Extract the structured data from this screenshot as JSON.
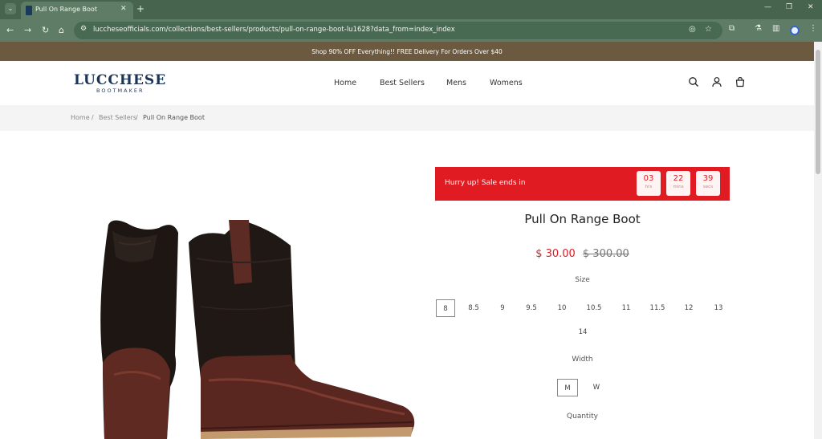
{
  "browser": {
    "tab_title": "Pull On Range Boot",
    "url": "luccheseofficials.com/collections/best-sellers/products/pull-on-range-boot-lu1628?data_from=index_index"
  },
  "promo": {
    "text": "Shop 90% OFF Everything!! FREE Delivery For Orders Over $40"
  },
  "header": {
    "logo_main": "LUCCHESE",
    "logo_sub": "BOOTMAKER",
    "nav": [
      "Home",
      "Best Sellers",
      "Mens",
      "Womens"
    ]
  },
  "breadcrumb": {
    "items": [
      "Home",
      "Best Sellers",
      "Pull On Range Boot"
    ],
    "separator": "/"
  },
  "countdown": {
    "label": "Hurry up!  Sale ends in",
    "units": [
      {
        "value": "03",
        "unit": "hrs"
      },
      {
        "value": "22",
        "unit": "mins"
      },
      {
        "value": "39",
        "unit": "secs"
      }
    ]
  },
  "product": {
    "title": "Pull On Range Boot",
    "price_sale": "$ 30.00",
    "price_original": "$ 300.00",
    "size_label": "Size",
    "sizes": [
      "8",
      "8.5",
      "9",
      "9.5",
      "10",
      "10.5",
      "11",
      "11.5",
      "12",
      "13",
      "14"
    ],
    "selected_size": "8",
    "width_label": "Width",
    "widths": [
      "M",
      "W"
    ],
    "selected_width": "M",
    "quantity_label": "Quantity"
  },
  "colors": {
    "sale_red": "#e01b22",
    "promo_bg": "#6c5a40",
    "brand_navy": "#1c3557",
    "chrome_green": "#5f7d66"
  }
}
